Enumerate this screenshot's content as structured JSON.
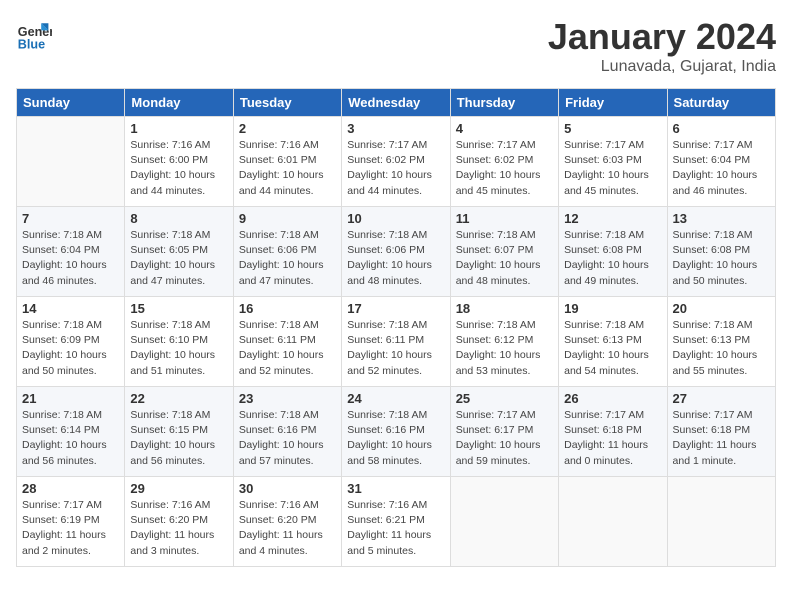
{
  "header": {
    "logo_line1": "General",
    "logo_line2": "Blue",
    "title": "January 2024",
    "subtitle": "Lunavada, Gujarat, India"
  },
  "days_of_week": [
    "Sunday",
    "Monday",
    "Tuesday",
    "Wednesday",
    "Thursday",
    "Friday",
    "Saturday"
  ],
  "weeks": [
    [
      {
        "date": "",
        "info": ""
      },
      {
        "date": "1",
        "info": "Sunrise: 7:16 AM\nSunset: 6:00 PM\nDaylight: 10 hours\nand 44 minutes."
      },
      {
        "date": "2",
        "info": "Sunrise: 7:16 AM\nSunset: 6:01 PM\nDaylight: 10 hours\nand 44 minutes."
      },
      {
        "date": "3",
        "info": "Sunrise: 7:17 AM\nSunset: 6:02 PM\nDaylight: 10 hours\nand 44 minutes."
      },
      {
        "date": "4",
        "info": "Sunrise: 7:17 AM\nSunset: 6:02 PM\nDaylight: 10 hours\nand 45 minutes."
      },
      {
        "date": "5",
        "info": "Sunrise: 7:17 AM\nSunset: 6:03 PM\nDaylight: 10 hours\nand 45 minutes."
      },
      {
        "date": "6",
        "info": "Sunrise: 7:17 AM\nSunset: 6:04 PM\nDaylight: 10 hours\nand 46 minutes."
      }
    ],
    [
      {
        "date": "7",
        "info": "Sunrise: 7:18 AM\nSunset: 6:04 PM\nDaylight: 10 hours\nand 46 minutes."
      },
      {
        "date": "8",
        "info": "Sunrise: 7:18 AM\nSunset: 6:05 PM\nDaylight: 10 hours\nand 47 minutes."
      },
      {
        "date": "9",
        "info": "Sunrise: 7:18 AM\nSunset: 6:06 PM\nDaylight: 10 hours\nand 47 minutes."
      },
      {
        "date": "10",
        "info": "Sunrise: 7:18 AM\nSunset: 6:06 PM\nDaylight: 10 hours\nand 48 minutes."
      },
      {
        "date": "11",
        "info": "Sunrise: 7:18 AM\nSunset: 6:07 PM\nDaylight: 10 hours\nand 48 minutes."
      },
      {
        "date": "12",
        "info": "Sunrise: 7:18 AM\nSunset: 6:08 PM\nDaylight: 10 hours\nand 49 minutes."
      },
      {
        "date": "13",
        "info": "Sunrise: 7:18 AM\nSunset: 6:08 PM\nDaylight: 10 hours\nand 50 minutes."
      }
    ],
    [
      {
        "date": "14",
        "info": "Sunrise: 7:18 AM\nSunset: 6:09 PM\nDaylight: 10 hours\nand 50 minutes."
      },
      {
        "date": "15",
        "info": "Sunrise: 7:18 AM\nSunset: 6:10 PM\nDaylight: 10 hours\nand 51 minutes."
      },
      {
        "date": "16",
        "info": "Sunrise: 7:18 AM\nSunset: 6:11 PM\nDaylight: 10 hours\nand 52 minutes."
      },
      {
        "date": "17",
        "info": "Sunrise: 7:18 AM\nSunset: 6:11 PM\nDaylight: 10 hours\nand 52 minutes."
      },
      {
        "date": "18",
        "info": "Sunrise: 7:18 AM\nSunset: 6:12 PM\nDaylight: 10 hours\nand 53 minutes."
      },
      {
        "date": "19",
        "info": "Sunrise: 7:18 AM\nSunset: 6:13 PM\nDaylight: 10 hours\nand 54 minutes."
      },
      {
        "date": "20",
        "info": "Sunrise: 7:18 AM\nSunset: 6:13 PM\nDaylight: 10 hours\nand 55 minutes."
      }
    ],
    [
      {
        "date": "21",
        "info": "Sunrise: 7:18 AM\nSunset: 6:14 PM\nDaylight: 10 hours\nand 56 minutes."
      },
      {
        "date": "22",
        "info": "Sunrise: 7:18 AM\nSunset: 6:15 PM\nDaylight: 10 hours\nand 56 minutes."
      },
      {
        "date": "23",
        "info": "Sunrise: 7:18 AM\nSunset: 6:16 PM\nDaylight: 10 hours\nand 57 minutes."
      },
      {
        "date": "24",
        "info": "Sunrise: 7:18 AM\nSunset: 6:16 PM\nDaylight: 10 hours\nand 58 minutes."
      },
      {
        "date": "25",
        "info": "Sunrise: 7:17 AM\nSunset: 6:17 PM\nDaylight: 10 hours\nand 59 minutes."
      },
      {
        "date": "26",
        "info": "Sunrise: 7:17 AM\nSunset: 6:18 PM\nDaylight: 11 hours\nand 0 minutes."
      },
      {
        "date": "27",
        "info": "Sunrise: 7:17 AM\nSunset: 6:18 PM\nDaylight: 11 hours\nand 1 minute."
      }
    ],
    [
      {
        "date": "28",
        "info": "Sunrise: 7:17 AM\nSunset: 6:19 PM\nDaylight: 11 hours\nand 2 minutes."
      },
      {
        "date": "29",
        "info": "Sunrise: 7:16 AM\nSunset: 6:20 PM\nDaylight: 11 hours\nand 3 minutes."
      },
      {
        "date": "30",
        "info": "Sunrise: 7:16 AM\nSunset: 6:20 PM\nDaylight: 11 hours\nand 4 minutes."
      },
      {
        "date": "31",
        "info": "Sunrise: 7:16 AM\nSunset: 6:21 PM\nDaylight: 11 hours\nand 5 minutes."
      },
      {
        "date": "",
        "info": ""
      },
      {
        "date": "",
        "info": ""
      },
      {
        "date": "",
        "info": ""
      }
    ]
  ]
}
